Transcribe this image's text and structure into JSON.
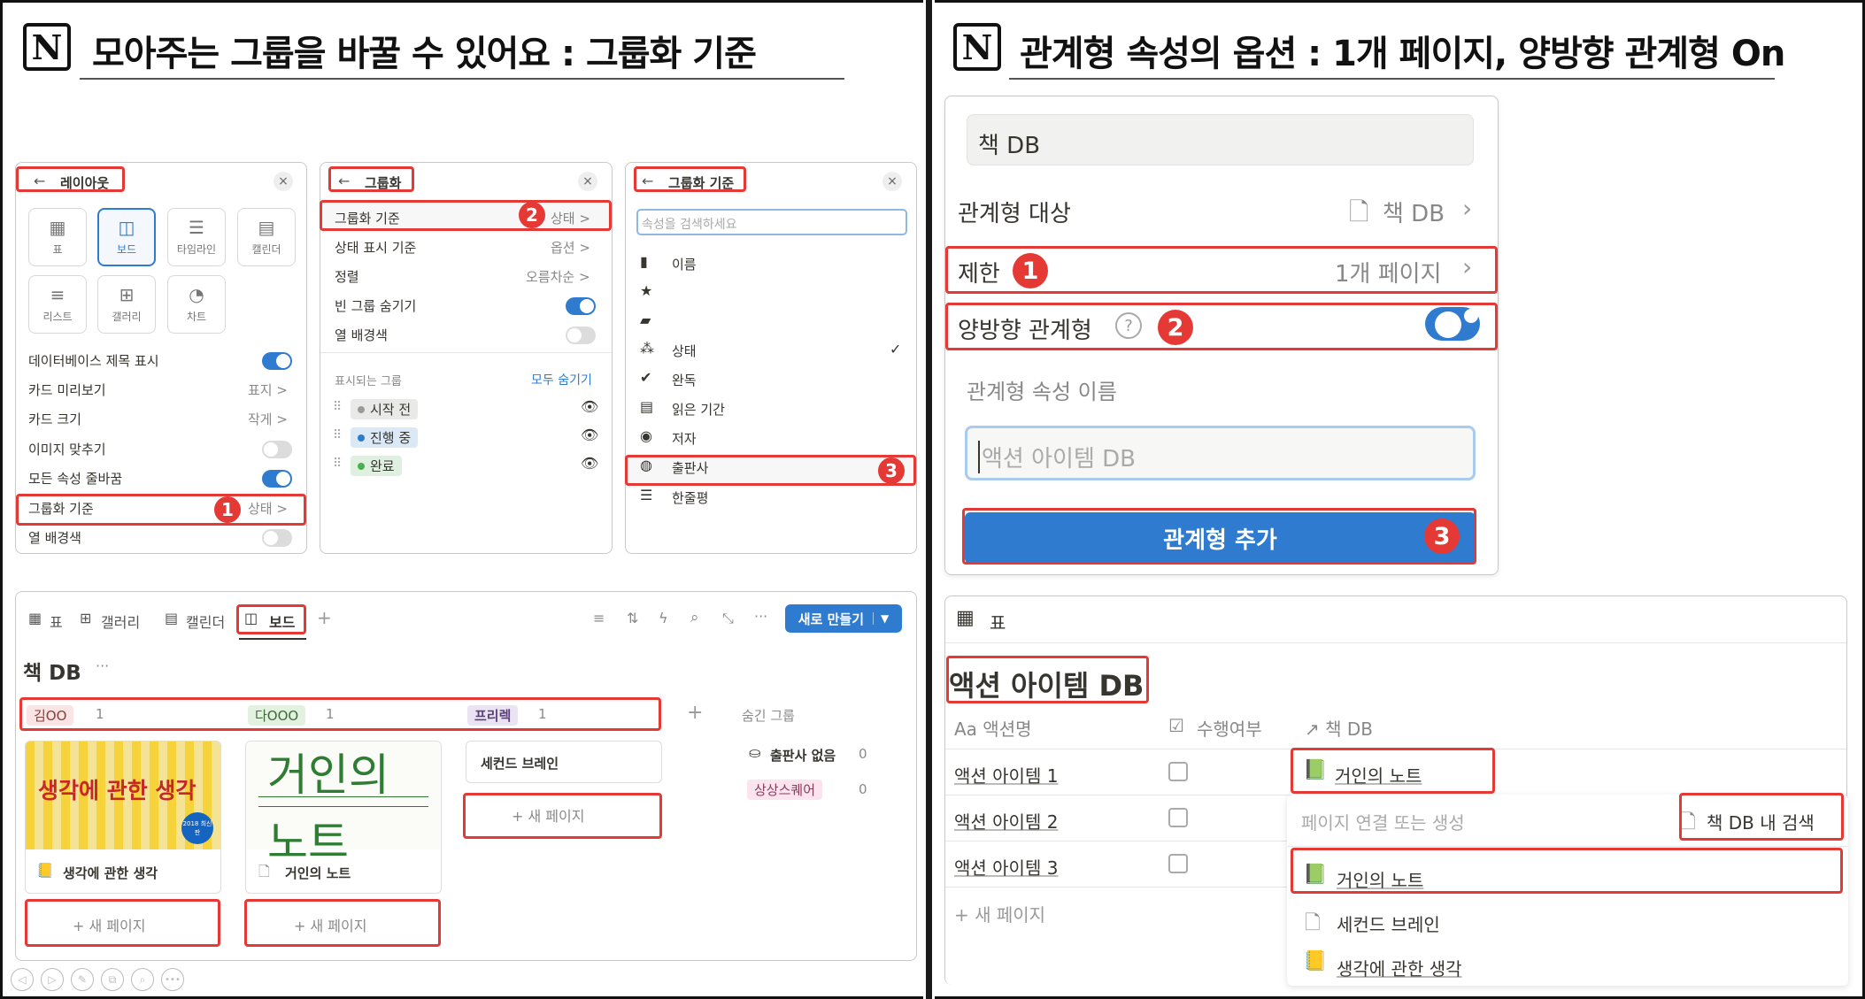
{
  "left": {
    "title": "모아주는 그룹을 바꿀 수 있어요 : 그룹화 기준",
    "layout_panel": {
      "title": "레이아웃",
      "tiles": [
        {
          "label": "표"
        },
        {
          "label": "보드"
        },
        {
          "label": "타임라인"
        },
        {
          "label": "캘린더"
        },
        {
          "label": "리스트"
        },
        {
          "label": "갤러리"
        },
        {
          "label": "차트"
        }
      ],
      "rows": [
        {
          "label": "데이터베이스 제목 표시",
          "toggle": true
        },
        {
          "label": "카드 미리보기",
          "value": "표지 >"
        },
        {
          "label": "카드 크기",
          "value": "작게 >"
        },
        {
          "label": "이미지 맞추기",
          "toggle": false
        },
        {
          "label": "모든 속성 줄바꿈",
          "toggle": true
        },
        {
          "label": "그룹화 기준",
          "value": "상태 >"
        },
        {
          "label": "열 배경색",
          "toggle": false
        }
      ]
    },
    "group_panel": {
      "title": "그룹화",
      "rows": [
        {
          "label": "그룹화 기준",
          "value": "상태 >"
        },
        {
          "label": "상태 표시 기준",
          "value": "옵션 >"
        },
        {
          "label": "정렬",
          "value": "오름차순 >"
        },
        {
          "label": "빈 그룹 숨기기",
          "toggle": true
        },
        {
          "label": "열 배경색",
          "toggle": false
        }
      ],
      "visible_label": "표시되는 그룹",
      "hide_all": "모두 숨기기",
      "groups": [
        {
          "label": "시작 전",
          "color": "#9b9a97",
          "bg": "#e9e9e7"
        },
        {
          "label": "진행 중",
          "color": "#2f7bd0",
          "bg": "#dbe9f7"
        },
        {
          "label": "완료",
          "color": "#4caf50",
          "bg": "#dff0e0"
        }
      ]
    },
    "groupby_panel": {
      "title": "그룹화 기준",
      "search_placeholder": "속성을 검색하세요",
      "items": [
        {
          "icon": "doc-icon",
          "label": "이름"
        },
        {
          "icon": "star-icon",
          "label": ""
        },
        {
          "icon": "note-icon",
          "label": ""
        },
        {
          "icon": "status-icon",
          "label": "상태",
          "check": "✓"
        },
        {
          "icon": "check-circle-icon",
          "label": "완독"
        },
        {
          "icon": "calendar-icon",
          "label": "읽은 기간"
        },
        {
          "icon": "person-icon",
          "label": "저자"
        },
        {
          "icon": "compass-icon",
          "label": "출판사"
        },
        {
          "icon": "lines-icon",
          "label": "한줄평"
        }
      ]
    },
    "board": {
      "tabs": [
        "표",
        "갤러리",
        "캘린더",
        "보드"
      ],
      "new_button": "새로 만들기",
      "db_title": "책 DB",
      "db_more": "···",
      "columns": [
        {
          "name": "김OO",
          "count": "1",
          "bg": "#fbe4e4",
          "color": "#8a3b3b"
        },
        {
          "name": "다OOO",
          "count": "1",
          "bg": "#e3f1e0",
          "color": "#3b6b35"
        },
        {
          "name": "프리렉",
          "count": "1",
          "bg": "#eae4f2",
          "color": "#5b3f7c"
        }
      ],
      "hidden_label": "숨긴 그룹",
      "hidden_groups": [
        {
          "name": "출판사 없음",
          "count": "0"
        },
        {
          "name": "상상스퀘어",
          "count": "0"
        }
      ],
      "cards": [
        {
          "title": "생각에 관한 생각",
          "cover_text": "생각에 관한 생각",
          "cover_sub": "2018 최신판"
        },
        {
          "title": "거인의 노트",
          "cover_text": "거인의",
          "cover_text2": "노트"
        },
        {
          "title": "세컨드 브레인"
        }
      ],
      "new_page": "+ 새 페이지"
    }
  },
  "right": {
    "title": "관계형 속성의 옵션 : 1개 페이지, 양방향 관계형 On",
    "relation_panel": {
      "name_value": "책 DB",
      "target_label": "관계형 대상",
      "target_value": "책 DB",
      "limit_label": "제한",
      "limit_value": "1개 페이지",
      "bidir_label": "양방향 관계형",
      "bidir_toggle": true,
      "prop_name_label": "관계형 속성 이름",
      "prop_name_placeholder": "액션 아이템 DB",
      "add_button": "관계형 추가"
    },
    "table": {
      "view_tab": "표",
      "db_title": "액션 아이템 DB",
      "headers": [
        "Aa 액션명",
        "수행여부",
        "↗ 책 DB"
      ],
      "rows": [
        {
          "name": "액션 아이템 1",
          "relation": "거인의 노트"
        },
        {
          "name": "액션 아이템 2",
          "relation": ""
        },
        {
          "name": "액션 아이템 3",
          "relation": ""
        }
      ],
      "new_page": "+ 새 페이지",
      "dropdown": {
        "placeholder": "페이지 연결 또는 생성",
        "search_in": "책 DB 내 검색",
        "items": [
          "거인의 노트",
          "세컨드 브레인",
          "생각에 관한 생각"
        ]
      }
    }
  },
  "badges": [
    "1",
    "2",
    "3"
  ],
  "colors": {
    "accent": "#2f7bd0",
    "highlight": "#e53935"
  }
}
